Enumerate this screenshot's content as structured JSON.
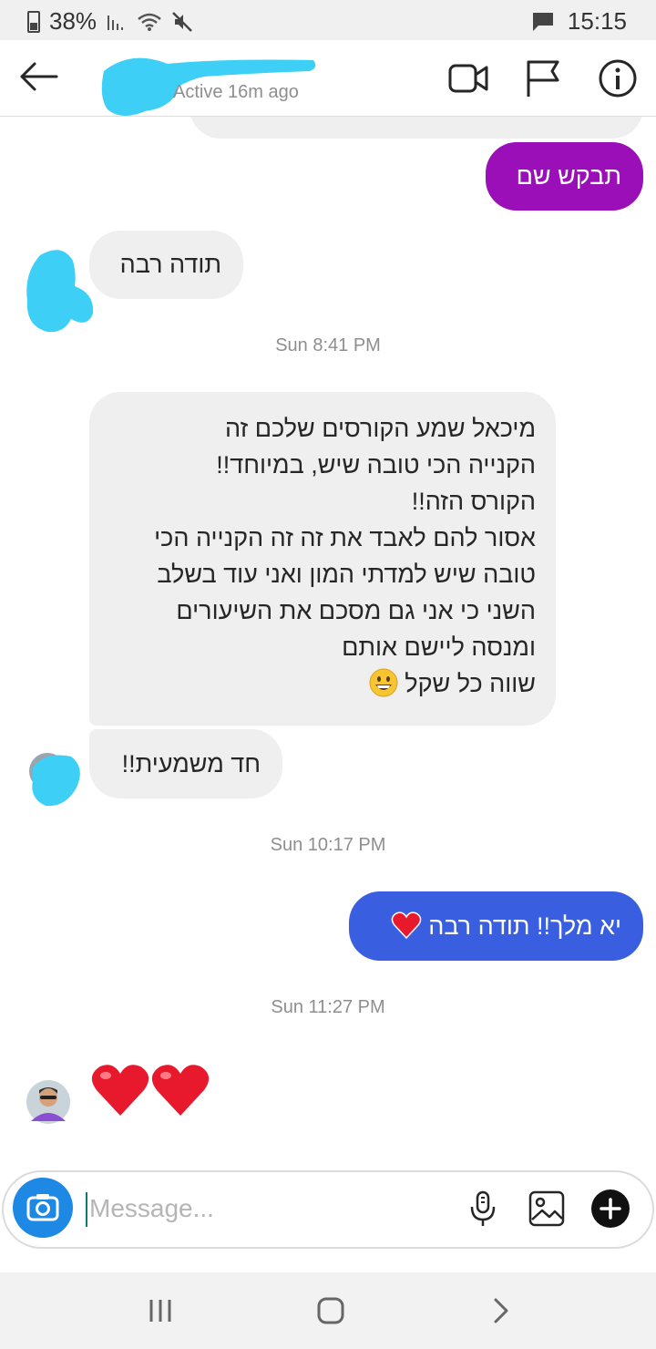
{
  "status_bar": {
    "battery": "38%",
    "time": "15:15",
    "icons": [
      "battery-icon",
      "signal-icon",
      "wifi-icon",
      "mute-icon",
      "message-icon"
    ]
  },
  "header": {
    "status": "Active 16m ago",
    "icons": [
      "back-arrow-icon",
      "video-call-icon",
      "flag-icon",
      "info-icon"
    ]
  },
  "messages": [
    {
      "from": "me",
      "text": "תבקש שם",
      "color": "#9b0fb8"
    },
    {
      "from": "them",
      "text": "תודה רבה"
    },
    {
      "timestamp": "Sun 8:41 PM"
    },
    {
      "from": "them",
      "lines": [
        "מיכאל שמע הקורסים שלכם זה",
        "הקנייה הכי טובה שיש, במיוחד!!",
        "הקורס הזה!!",
        "אסור להם לאבד את זה זה הקנייה הכי",
        "טובה שיש למדתי המון ואני עוד בשלב",
        "השני כי אני גם מסכם את השיעורים",
        "ומנסה ליישם אותם",
        "שווה כל שקל"
      ],
      "emoji": "grinning-face-icon"
    },
    {
      "from": "them",
      "text": "חד משמעית!!"
    },
    {
      "timestamp": "Sun 10:17 PM"
    },
    {
      "from": "me",
      "text": "יא מלך!! תודה רבה",
      "emoji": "red-heart-icon",
      "color": "#3a5ee0"
    },
    {
      "timestamp": "Sun 11:27 PM"
    },
    {
      "from": "them",
      "hearts": 2
    }
  ],
  "composer": {
    "placeholder": "Message...",
    "icons": [
      "camera-icon",
      "microphone-icon",
      "gallery-icon",
      "add-icon"
    ]
  },
  "nav_bar": {
    "icons": [
      "recent-apps-icon",
      "home-icon",
      "back-nav-icon"
    ]
  },
  "colors": {
    "accent_blue": "#3a5ee0",
    "accent_purple": "#9b0fb8",
    "scribble": "#3dcff5",
    "camera": "#1e88e5"
  }
}
